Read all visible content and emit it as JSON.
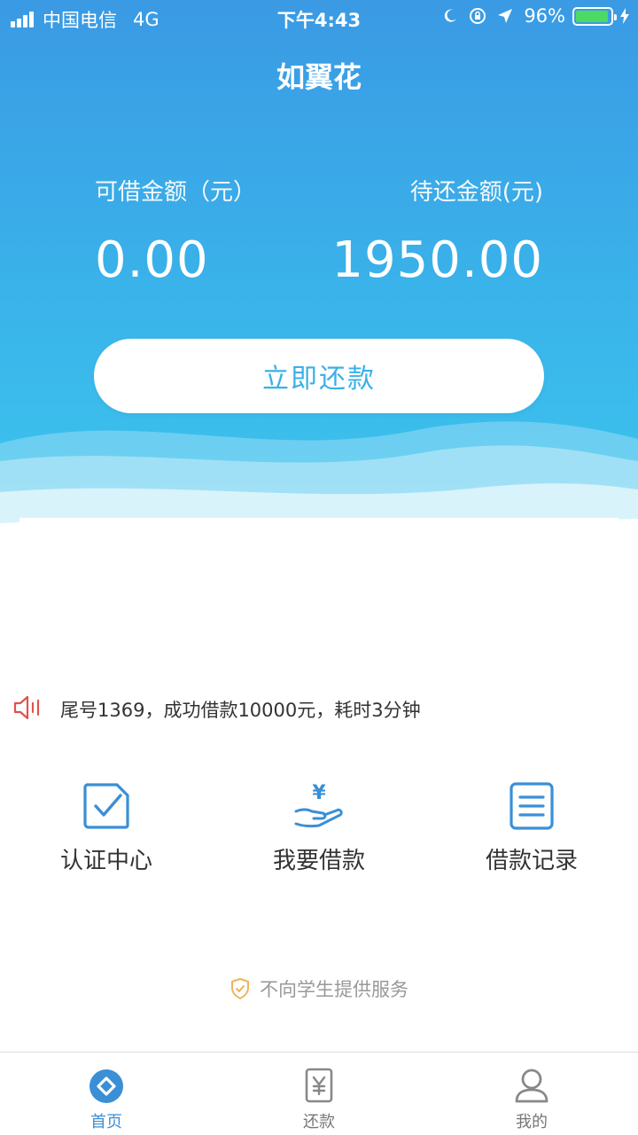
{
  "status_bar": {
    "carrier": "中国电信",
    "network": "4G",
    "time": "下午4:43",
    "battery_percent": "96%",
    "battery_level": 0.96,
    "icons": [
      "moon-icon",
      "rotation-lock-icon",
      "location-arrow-icon",
      "charging-bolt-icon"
    ]
  },
  "app": {
    "title": "如翼花"
  },
  "summary": {
    "available_label": "可借金额（元）",
    "available_value": "0.00",
    "pending_label": "待还金额(元)",
    "pending_value": "1950.00"
  },
  "repay_button": {
    "label": "立即还款"
  },
  "notice": {
    "icon": "speaker-icon",
    "text": "尾号1369，成功借款10000元，耗时3分钟"
  },
  "actions": [
    {
      "icon": "checkbox-icon",
      "label": "认证中心"
    },
    {
      "icon": "money-hand-icon",
      "label": "我要借款"
    },
    {
      "icon": "list-document-icon",
      "label": "借款记录"
    }
  ],
  "disclaimer": {
    "icon": "shield-check-icon",
    "text": "不向学生提供服务"
  },
  "tabbar": [
    {
      "icon": "home-icon",
      "label": "首页",
      "active": true
    },
    {
      "icon": "yuan-card-icon",
      "label": "还款",
      "active": false
    },
    {
      "icon": "user-icon",
      "label": "我的",
      "active": false
    }
  ],
  "colors": {
    "primary_blue": "#3a9ae4",
    "accent_cyan": "#3bb0e8",
    "tab_active": "#3a8fd6",
    "notice_red": "#e0534a",
    "shield_orange": "#f0b25a",
    "battery_green": "#4cd964"
  }
}
